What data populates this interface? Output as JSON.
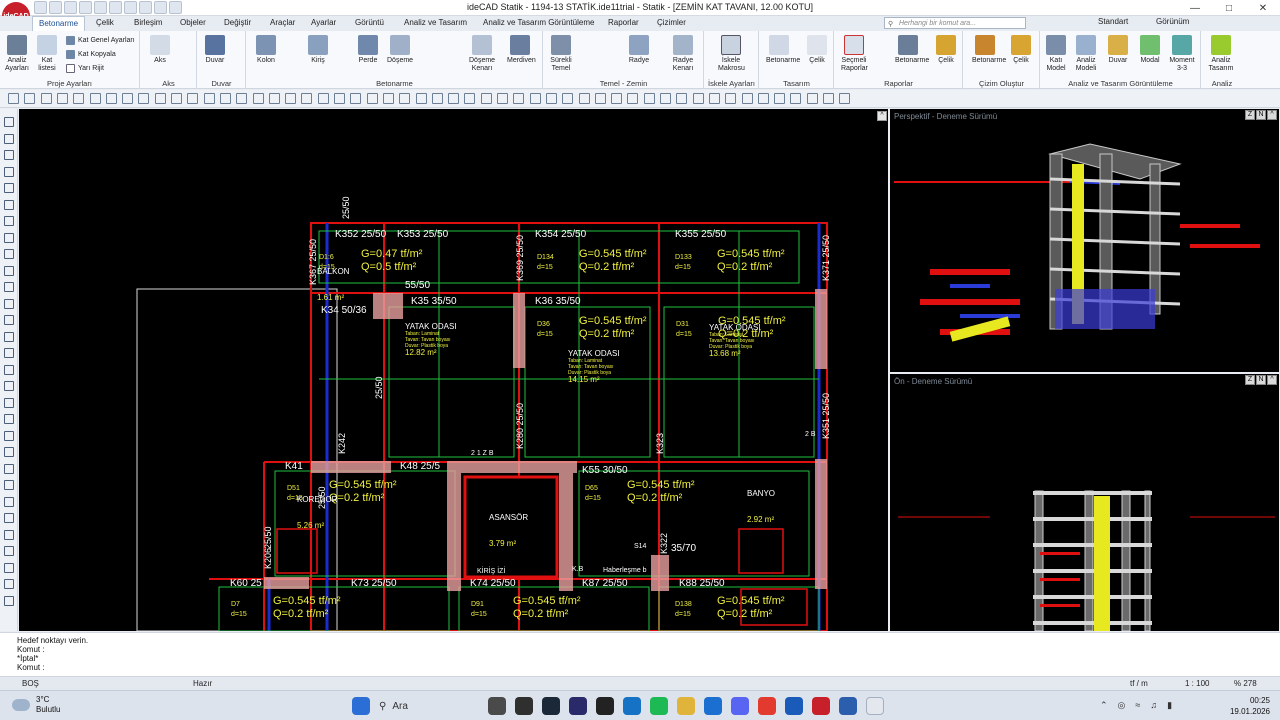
{
  "window": {
    "title": "ideCAD Statik - 1194-13 STATİK.ide11trial - Statik - [ZEMİN KAT TAVANI, 12.00 KOTU]",
    "logo": "ideCAD"
  },
  "menu": {
    "tabs": [
      "Betonarme",
      "Çelik",
      "Birleşim",
      "Objeler",
      "Değiştir",
      "Araçlar",
      "Ayarlar",
      "Görüntü",
      "Analiz ve Tasarım",
      "Analiz ve Tasarım Görüntüleme",
      "Raporlar",
      "Çizimler"
    ],
    "search_placeholder": "Herhangi bir komut ara...",
    "standard_label": "Standart",
    "view_label": "Görünüm"
  },
  "ribbon": {
    "groups": [
      {
        "label": "Proje Ayarları",
        "buttons": [
          "Analiz Ayarları",
          "Kat listesi"
        ],
        "small": [
          "Kat Genel Ayarları",
          "Kat Kopyala",
          "Yarı Rijit"
        ]
      },
      {
        "label": "Aks",
        "buttons": [
          "Aks"
        ]
      },
      {
        "label": "Duvar",
        "buttons": [
          "Duvar"
        ]
      },
      {
        "label": "Betonarme",
        "buttons": [
          "Kolon",
          "Kiriş",
          "Perde",
          "Döşeme",
          "Döşeme Kenarı",
          "Merdiven"
        ]
      },
      {
        "label": "Temel - Zemin",
        "buttons": [
          "Sürekli Temel",
          "Radye",
          "Radye Kenarı"
        ]
      },
      {
        "label": "İskele Ayarları",
        "buttons": [
          "İskele Makrosu"
        ]
      },
      {
        "label": "Tasarım",
        "buttons": [
          "Betonarme",
          "Çelik"
        ]
      },
      {
        "label": "Raporlar",
        "buttons": [
          "Seçmeli Raporlar",
          "Betonarme",
          "Çelik"
        ]
      },
      {
        "label": "Çizim Oluştur",
        "buttons": [
          "Betonarme",
          "Çelik"
        ]
      },
      {
        "label": "Analiz ve Tasarım Görüntüleme",
        "buttons": [
          "Katı Model",
          "Analiz Modeli",
          "Duvar",
          "Modal",
          "Moment 3-3"
        ]
      },
      {
        "label": "Analiz",
        "buttons": [
          "Analiz Tasarım"
        ]
      }
    ]
  },
  "cad": {
    "beams": [
      "K352 25/50",
      "K353 25/50",
      "K354 25/50",
      "K355 25/50",
      "K35 35/50",
      "K36 35/50",
      "K34 50/36",
      "K41",
      "K48 25/5",
      "K55 30/50",
      "K60 25",
      "K73 25/50",
      "K74 25/50",
      "K87 25/50",
      "K88 25/50",
      "55/50",
      "35/70"
    ],
    "vertical_labels": [
      "K367 25/50",
      "K369 25/50",
      "K371 25/50",
      "K280 25/50",
      "K323",
      "K351 25/50",
      "K242",
      "K206",
      "K322",
      "25/50",
      "25/50",
      "25/50",
      "25/50"
    ],
    "slabs": [
      {
        "id": "D1:6",
        "d": "d=15",
        "g": "G=0.47 tf/m²",
        "q": "Q=0.5 tf/m²"
      },
      {
        "id": "D134",
        "d": "d=15",
        "g": "G=0.545 tf/m²",
        "q": "Q=0.2 tf/m²"
      },
      {
        "id": "D133",
        "d": "d=15",
        "g": "G=0.545 tf/m²",
        "q": "Q=0.2 tf/m²"
      },
      {
        "id": "D36",
        "d": "d=15",
        "g": "G=0.545 tf/m²",
        "q": "Q=0.2 tf/m²"
      },
      {
        "id": "D31",
        "d": "d=15",
        "g": "G=0.545 tf/m²",
        "q": "Q=0.2 tf/m²"
      },
      {
        "id": "D51",
        "d": "d=15",
        "g": "G=0.545 tf/m²",
        "q": "Q=0.2 tf/m²"
      },
      {
        "id": "D65",
        "d": "d=15",
        "g": "G=0.545 tf/m²",
        "q": "Q=0.2 tf/m²"
      },
      {
        "id": "D7",
        "d": "d=15",
        "g": "G=0.545 tf/m²",
        "q": "Q=0.2 tf/m²"
      },
      {
        "id": "D91",
        "d": "d=15",
        "g": "G=0.545 tf/m²",
        "q": "Q=0.2 tf/m²"
      },
      {
        "id": "D138",
        "d": "d=15",
        "g": "G=0.545 tf/m²",
        "q": "Q=0.2 tf/m²"
      }
    ],
    "rooms": [
      {
        "name": "BALKON",
        "area": "1.61 m²"
      },
      {
        "name": "YATAK ODASI",
        "area": "12.82 m²"
      },
      {
        "name": "YATAK ODASI",
        "area": "14.15 m²"
      },
      {
        "name": "YATAK ODASI",
        "area": "13.68 m²"
      },
      {
        "name": "ASANSÖR",
        "area": "3.79 m²"
      },
      {
        "name": "BANYO",
        "area": "2.92 m²"
      },
      {
        "name": "KOREDOR",
        "area": "5.26 m²"
      }
    ],
    "room_notes": [
      "Taban: Laminat",
      "Tavan: Tavan boyası",
      "Duvar: Plastik boya"
    ],
    "misc": [
      "KİRİŞ İZİ",
      "Haberleşme b",
      "S14",
      "K.B",
      "2 1 Z B",
      "2 B"
    ]
  },
  "views": {
    "perspective_title": "Perspektif - Deneme Sürümü",
    "front_title": "Ön - Deneme Sürümü"
  },
  "command": {
    "lines": [
      "Hedef noktayı verin.",
      "Komut :",
      "*İptal*",
      "Komut :"
    ]
  },
  "status": {
    "mode": "BOŞ",
    "state": "Hazır",
    "unit": "tf / m",
    "scale": "1 : 100",
    "zoom": "% 278"
  },
  "taskbar": {
    "temperature": "3°C",
    "weather": "Bulutlu",
    "search": "Ara",
    "time": "00:25",
    "date": "19.01.2026"
  },
  "colors": {
    "accent": "#1b4f93",
    "cad_background": "#000000",
    "beam_red": "#e01010",
    "slab_green": "#20c040",
    "text_yellow": "#f0f040",
    "label_white": "#ffffff",
    "hatch_pink": "#e8a0a0"
  }
}
